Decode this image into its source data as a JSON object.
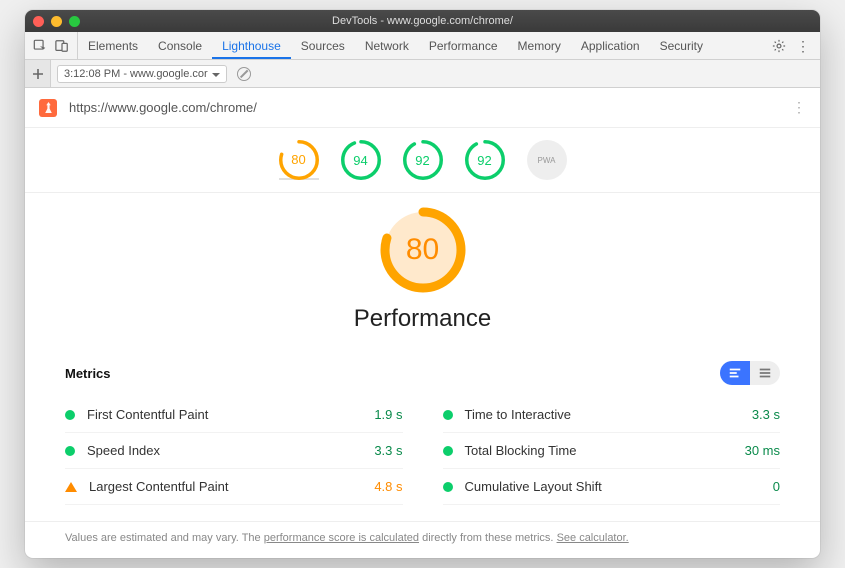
{
  "window": {
    "title": "DevTools - www.google.com/chrome/"
  },
  "tabs": {
    "items": [
      "Elements",
      "Console",
      "Lighthouse",
      "Sources",
      "Network",
      "Performance",
      "Memory",
      "Application",
      "Security"
    ],
    "active_index": 2
  },
  "subbar": {
    "chip": "3:12:08 PM - www.google.cor"
  },
  "urlrow": {
    "url": "https://www.google.com/chrome/"
  },
  "gauge_colors": {
    "avg": "#ffa400",
    "good": "#0cce6b"
  },
  "mini_gauges": [
    {
      "score": 80,
      "level": "avg"
    },
    {
      "score": 94,
      "level": "good"
    },
    {
      "score": 92,
      "level": "good"
    },
    {
      "score": 92,
      "level": "good"
    }
  ],
  "pwa_badge": "PWA",
  "main_gauge": {
    "score": 80,
    "title": "Performance",
    "level": "avg"
  },
  "metrics_header": "Metrics",
  "metrics": [
    {
      "name": "First Contentful Paint",
      "value": "1.9 s",
      "level": "good",
      "value_level": "good"
    },
    {
      "name": "Time to Interactive",
      "value": "3.3 s",
      "level": "good",
      "value_level": "good"
    },
    {
      "name": "Speed Index",
      "value": "3.3 s",
      "level": "good",
      "value_level": "good"
    },
    {
      "name": "Total Blocking Time",
      "value": "30 ms",
      "level": "good",
      "value_level": "good"
    },
    {
      "name": "Largest Contentful Paint",
      "value": "4.8 s",
      "level": "avg",
      "value_level": "avg"
    },
    {
      "name": "Cumulative Layout Shift",
      "value": "0",
      "level": "good",
      "value_level": "good"
    }
  ],
  "footnote": {
    "prefix": "Values are estimated and may vary. The ",
    "link1": "performance score is calculated",
    "mid": " directly from these metrics. ",
    "link2": "See calculator."
  }
}
